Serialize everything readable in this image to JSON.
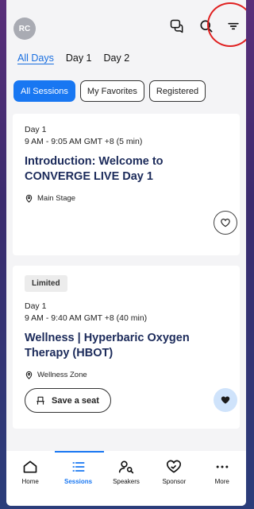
{
  "header": {
    "avatar_initials": "RC",
    "icons": [
      "chat-icon",
      "search-icon",
      "filter-icon"
    ]
  },
  "day_tabs": [
    {
      "label": "All Days",
      "active": true
    },
    {
      "label": "Day 1",
      "active": false
    },
    {
      "label": "Day 2",
      "active": false
    }
  ],
  "filter_chips": [
    {
      "label": "All Sessions",
      "active": true
    },
    {
      "label": "My Favorites",
      "active": false
    },
    {
      "label": "Registered",
      "active": false
    }
  ],
  "sessions": [
    {
      "badge": "",
      "day": "Day 1",
      "time": "9 AM - 9:05 AM GMT +8  (5 min)",
      "title": "Introduction: Welcome to CONVERGE LIVE Day 1",
      "location": "Main Stage",
      "favorited": false
    },
    {
      "badge": "Limited",
      "day": "Day 1",
      "time": "9 AM - 9:40 AM GMT +8  (40 min)",
      "title": "Wellness | Hyperbaric Oxygen Therapy (HBOT)",
      "location": "Wellness Zone",
      "action_label": "Save a seat",
      "favorited": true
    }
  ],
  "bottom_nav": [
    {
      "label": "Home",
      "icon": "home-icon",
      "active": false
    },
    {
      "label": "Sessions",
      "icon": "list-icon",
      "active": true
    },
    {
      "label": "Speakers",
      "icon": "speaker-icon",
      "active": false
    },
    {
      "label": "Sponsor",
      "icon": "handshake-heart-icon",
      "active": false
    },
    {
      "label": "More",
      "icon": "more-icon",
      "active": false
    }
  ],
  "colors": {
    "accent": "#1877f2",
    "title": "#1b2a5a",
    "highlight_ring": "#e02020"
  }
}
